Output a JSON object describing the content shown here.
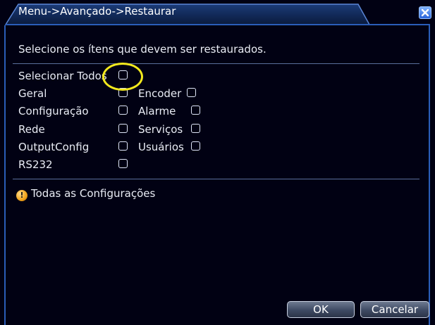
{
  "title": "Menu->Avançado->Restaurar",
  "instruction": "Selecione os ítens que devem ser restaurados.",
  "select_all_label": "Selecionar Todos",
  "options": {
    "geral": "Geral",
    "configuracao": "Configuração",
    "rede": "Rede",
    "output_config": "OutputConfig",
    "rs232": "RS232",
    "encoder": "Encoder",
    "alarme": "Alarme",
    "servicos": "Serviços",
    "usuarios": "Usuários"
  },
  "info_message": "Todas as Configurações",
  "buttons": {
    "ok": "OK",
    "cancel": "Cancelar"
  },
  "colors": {
    "background": "#010113",
    "frame": "#2a5db8",
    "highlight": "#f3e91d",
    "info": "#f0a21a"
  },
  "icons": {
    "close": "close-icon",
    "info": "info-icon"
  }
}
